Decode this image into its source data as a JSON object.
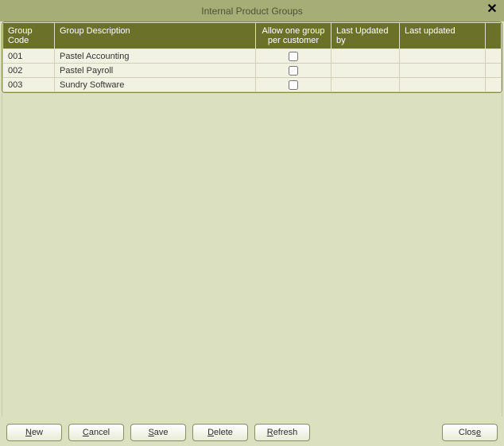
{
  "title": "Internal Product Groups",
  "close_glyph": "✕",
  "columns": {
    "code": "Group Code",
    "desc": "Group Description",
    "allow": "Allow one group per customer",
    "updated_by": "Last Updated by",
    "updated_at": "Last updated"
  },
  "rows": [
    {
      "code": "001",
      "desc": "Pastel Accounting",
      "allow": false,
      "updated_by": "",
      "updated_at": ""
    },
    {
      "code": "002",
      "desc": "Pastel Payroll",
      "allow": false,
      "updated_by": "",
      "updated_at": ""
    },
    {
      "code": "003",
      "desc": "Sundry Software",
      "allow": false,
      "updated_by": "",
      "updated_at": ""
    }
  ],
  "buttons": {
    "new": {
      "pre": "",
      "ul": "N",
      "post": "ew"
    },
    "cancel": {
      "pre": "",
      "ul": "C",
      "post": "ancel"
    },
    "save": {
      "pre": "",
      "ul": "S",
      "post": "ave"
    },
    "delete": {
      "pre": "",
      "ul": "D",
      "post": "elete"
    },
    "refresh": {
      "pre": "",
      "ul": "R",
      "post": "efresh"
    },
    "close": {
      "pre": "Clos",
      "ul": "e",
      "post": ""
    }
  }
}
